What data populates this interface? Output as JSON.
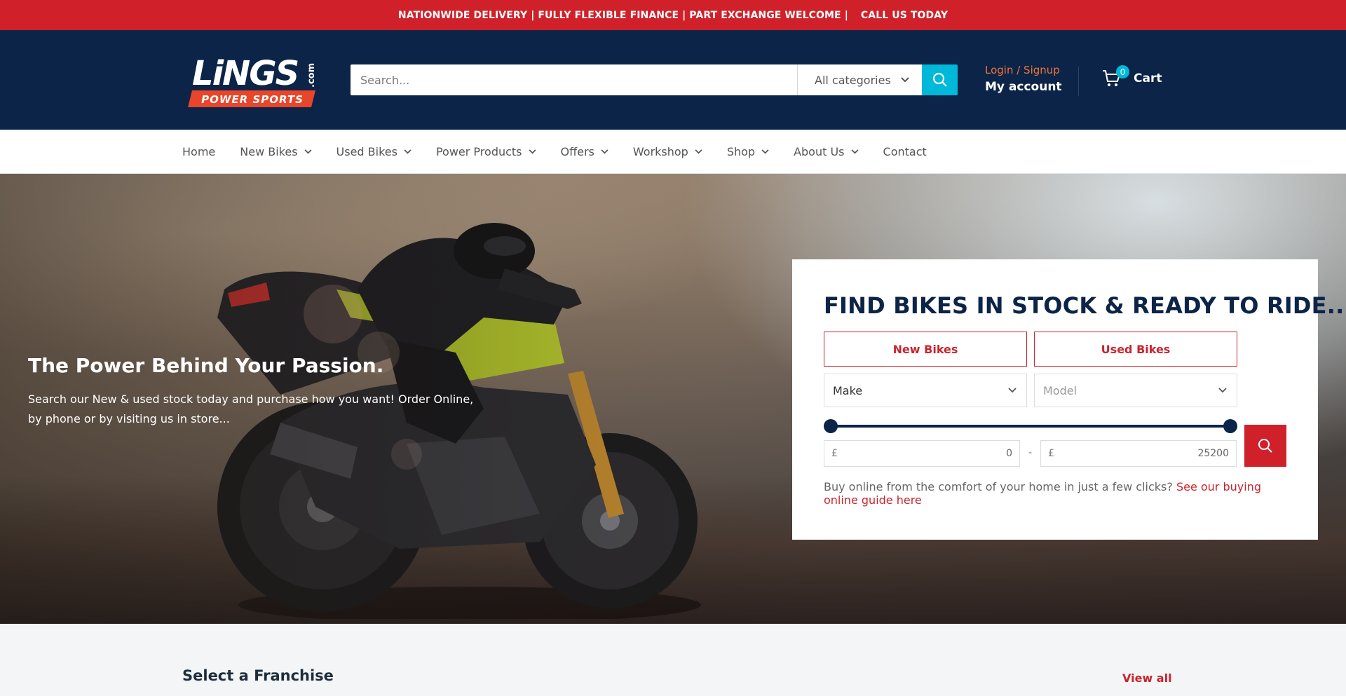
{
  "topbar": {
    "message": "NATIONWIDE DELIVERY | FULLY FLEXIBLE FINANCE | PART EXCHANGE WELCOME |",
    "cta": "CALL US TODAY"
  },
  "header": {
    "logo": {
      "wordmark": "LiNGS",
      "suffix": ".com",
      "tagline": "POWER SPORTS"
    },
    "search": {
      "placeholder": "Search...",
      "category": "All categories"
    },
    "account": {
      "login": "Login / Signup",
      "my_account": "My account"
    },
    "cart": {
      "count": "0",
      "label": "Cart"
    }
  },
  "nav": {
    "items": [
      {
        "label": "Home"
      },
      {
        "label": "New Bikes"
      },
      {
        "label": "Used Bikes"
      },
      {
        "label": "Power Products"
      },
      {
        "label": "Offers"
      },
      {
        "label": "Workshop"
      },
      {
        "label": "Shop"
      },
      {
        "label": "About Us"
      },
      {
        "label": "Contact"
      }
    ]
  },
  "hero": {
    "title": "The Power Behind Your Passion.",
    "text": "Search our New & used stock today and purchase how you want! Order Online, by phone or by visiting us in store..."
  },
  "finder": {
    "title": "FIND BIKES IN STOCK & READY TO RIDE...",
    "tabs": {
      "new": "New Bikes",
      "used": "Used Bikes"
    },
    "make": "Make",
    "model": "Model",
    "currency": "£",
    "price_min": "0",
    "price_max": "25200",
    "separator": "-",
    "note": "Buy online from the comfort of your home in just a few clicks?",
    "note_link": "See our buying online guide here"
  },
  "franchise": {
    "title": "Select a Franchise",
    "view_all": "View all"
  },
  "colors": {
    "brand_red": "#d0202a",
    "navy": "#0b2447",
    "accent_cyan": "#00b8d9",
    "login_orange": "#f0743a"
  }
}
